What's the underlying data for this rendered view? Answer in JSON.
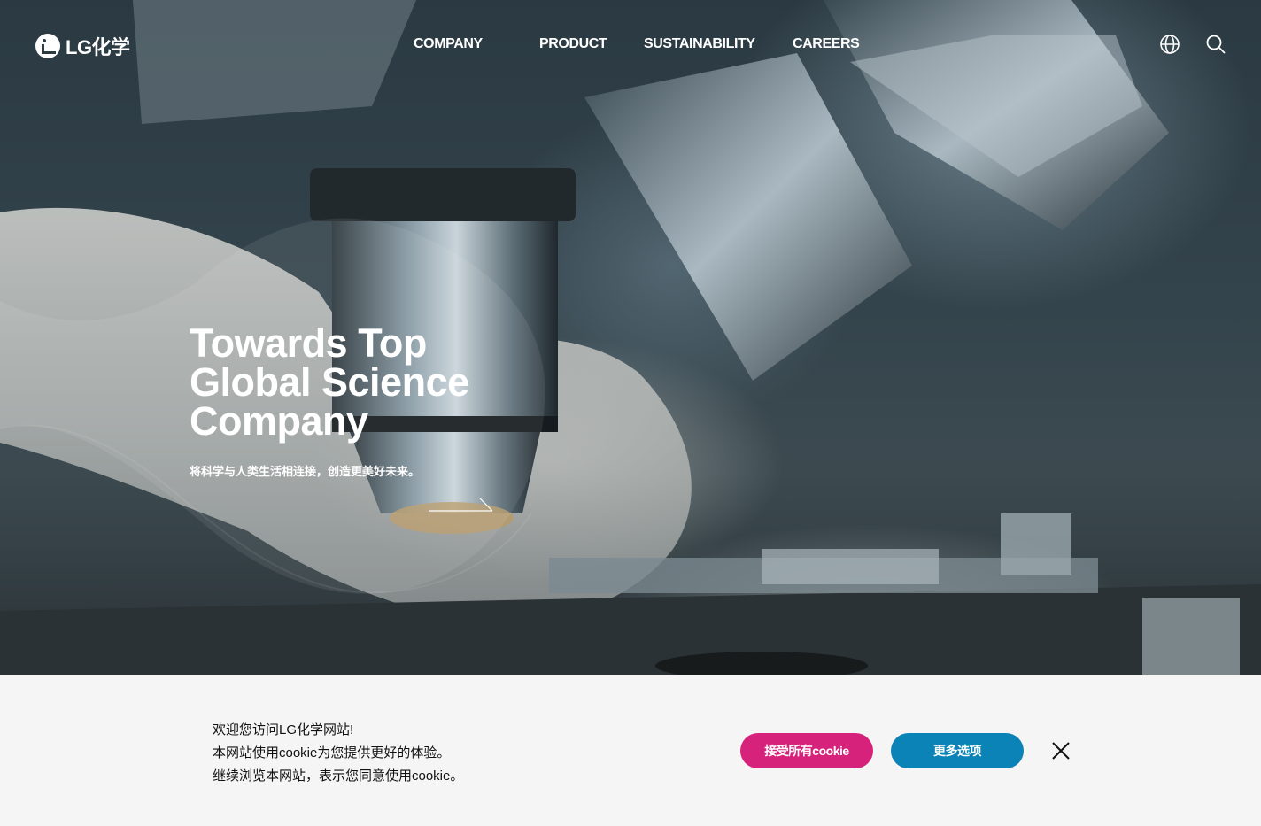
{
  "header": {
    "logo_text": "LG化学",
    "nav": [
      {
        "label": "COMPANY"
      },
      {
        "label": "PRODUCT"
      },
      {
        "label": "SUSTAINABILITY"
      },
      {
        "label": "CAREERS"
      }
    ],
    "icons": [
      "globe-icon",
      "search-icon"
    ]
  },
  "hero": {
    "title_lines": [
      "Towards Top",
      "Global Science",
      "Company"
    ],
    "subtitle": "将科学与人类生活相连接，创造更美好未来。",
    "arrow_icon": "arrow-right-icon"
  },
  "cookie": {
    "lines": [
      "欢迎您访问LG化学网站!",
      "本网站使用cookie为您提供更好的体验。",
      "继续浏览本网站，表示您同意使用cookie。"
    ],
    "accept_label": "接受所有cookie",
    "more_label": "更多选项",
    "close_icon": "close-icon",
    "accept_color": "#d6227a",
    "more_color": "#0b83b7"
  }
}
